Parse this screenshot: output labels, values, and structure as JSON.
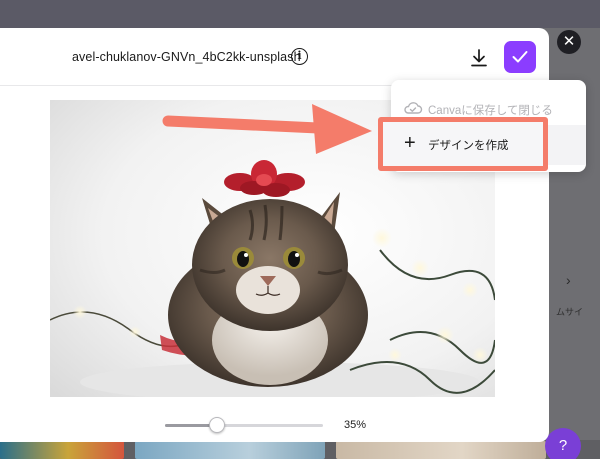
{
  "header": {
    "file_name": "avel-chuklanov-GNVn_4bC2kk-unsplash",
    "info_icon": "info-icon",
    "download_icon": "download-icon",
    "confirm_icon": "checkmark-icon"
  },
  "menu": {
    "save_and_close": "Canvaに保存して閉じる",
    "create_design": "デザインを作成"
  },
  "zoom": {
    "level_label": "35%",
    "slider_fraction": 0.33
  },
  "background": {
    "side_text": "ムサイ",
    "help_label": "?"
  },
  "colors": {
    "accent": "#8b3dff",
    "annotation": "#f47c6a"
  }
}
